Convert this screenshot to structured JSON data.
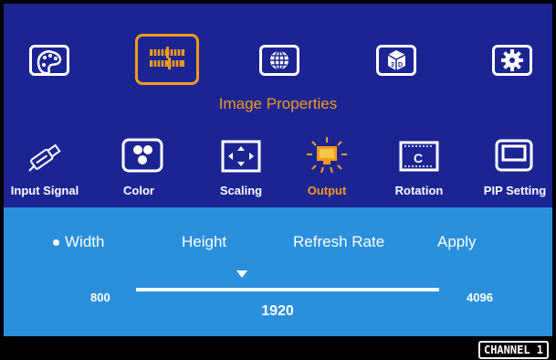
{
  "top_menu": {
    "items": [
      {
        "name": "palette",
        "icon": "palette-icon"
      },
      {
        "name": "image-properties",
        "icon": "adjust-bars-icon",
        "selected": true
      },
      {
        "name": "network",
        "icon": "globe-icon"
      },
      {
        "name": "3d",
        "icon": "3d-cube-icon"
      },
      {
        "name": "settings",
        "icon": "gear-icon"
      }
    ]
  },
  "section_title": "Image Properties",
  "submenu": {
    "items": [
      {
        "label": "Input Signal",
        "icon": "usb-plug-icon"
      },
      {
        "label": "Color",
        "icon": "color-dots-icon"
      },
      {
        "label": "Scaling",
        "icon": "scaling-arrows-icon"
      },
      {
        "label": "Output",
        "icon": "output-monitor-icon",
        "active": true
      },
      {
        "label": "Rotation",
        "icon": "rotation-icon"
      },
      {
        "label": "PIP Setting",
        "icon": "pip-window-icon"
      }
    ]
  },
  "options": {
    "width": "Width",
    "height": "Height",
    "refresh_rate": "Refresh Rate",
    "apply": "Apply"
  },
  "slider": {
    "min_label": "800",
    "max_label": "4096",
    "value_label": "1920",
    "value": 1920,
    "min": 800,
    "max": 4096
  },
  "status": {
    "channel": "CHANNEL 1"
  },
  "colors": {
    "accent": "#f39a1c",
    "top_bg": "#1c2494",
    "bottom_bg": "#2a90dd"
  }
}
